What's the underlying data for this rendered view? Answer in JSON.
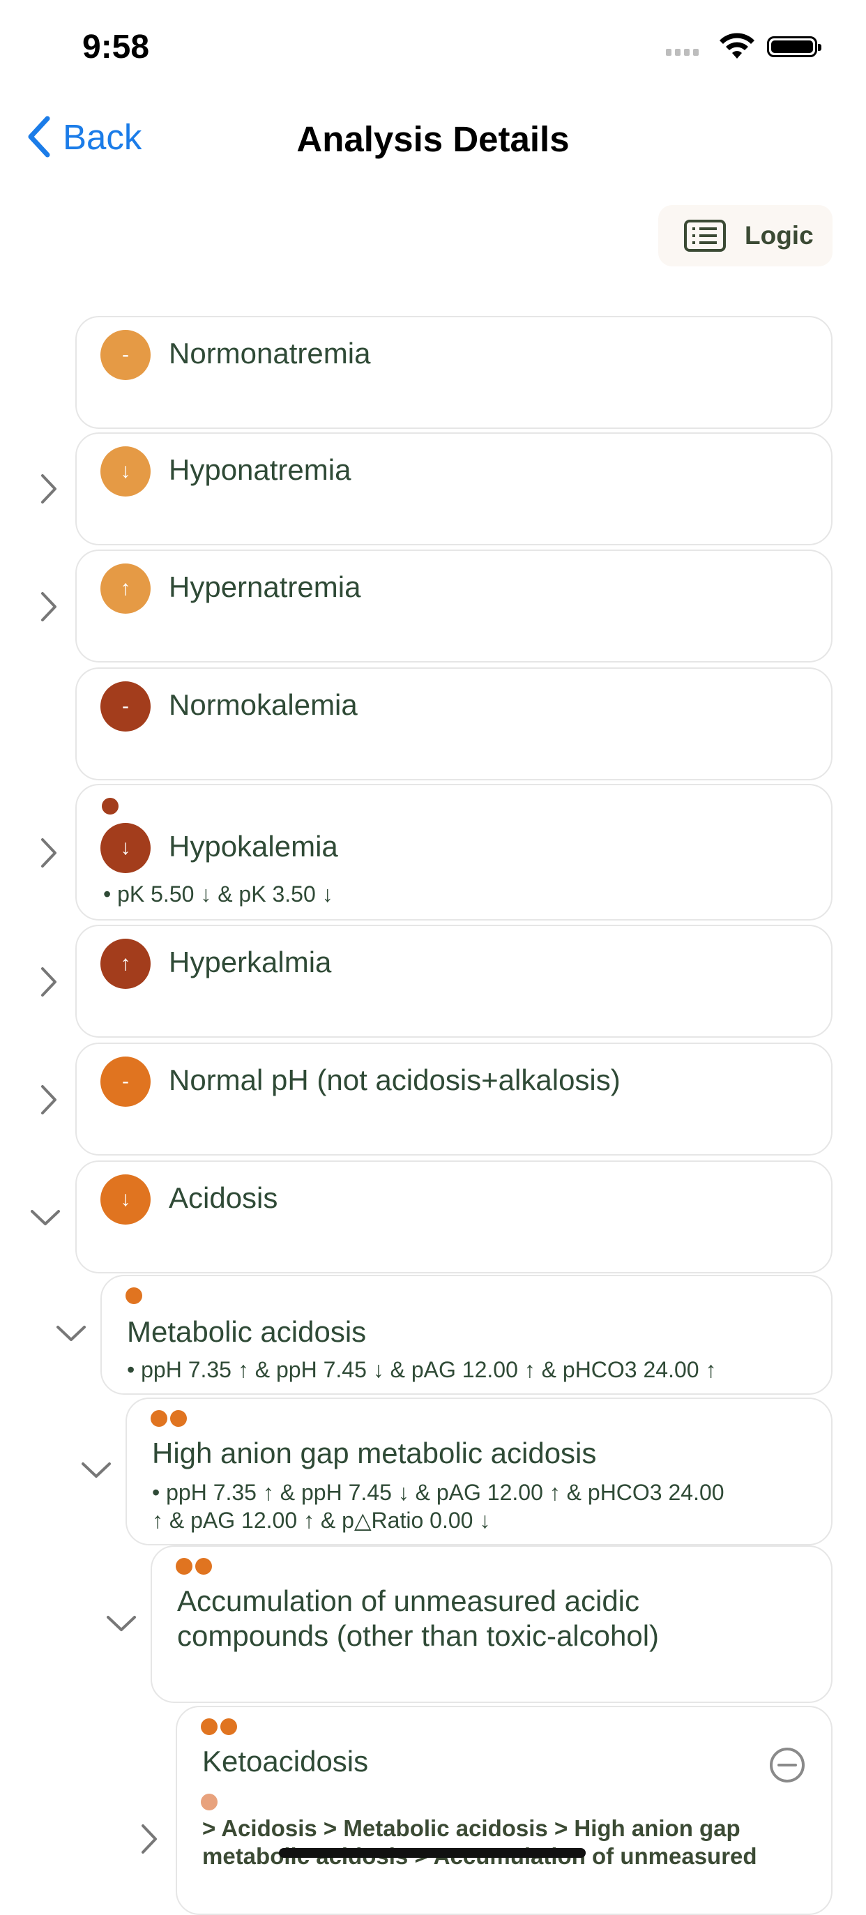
{
  "status": {
    "time": "9:58"
  },
  "nav": {
    "back_label": "Back",
    "title": "Analysis Details"
  },
  "toolbar": {
    "logic_label": "Logic"
  },
  "colors": {
    "sodium": "#e59a45",
    "potassium": "#a33d1c",
    "ph": "#e07420",
    "ph_dot": "#e07420",
    "light_dot": "#e8a27d"
  },
  "items": [
    {
      "title": "Normonatremia",
      "symbol": "-",
      "chevron": "none"
    },
    {
      "title": "Hyponatremia",
      "symbol": "↓",
      "chevron": "right"
    },
    {
      "title": "Hypernatremia",
      "symbol": "↑",
      "chevron": "right"
    },
    {
      "title": "Normokalemia",
      "symbol": "-",
      "chevron": "none"
    },
    {
      "title": "Hypokalemia",
      "symbol": "↓",
      "chevron": "right",
      "rule": "• pK 5.50 ↓ & pK 3.50 ↓"
    },
    {
      "title": "Hyperkalmia",
      "symbol": "↑",
      "chevron": "right"
    },
    {
      "title": "Normal pH (not acidosis+alkalosis)",
      "symbol": "-",
      "chevron": "right"
    },
    {
      "title": "Acidosis",
      "symbol": "↓",
      "chevron": "down"
    },
    {
      "title": "Metabolic acidosis",
      "chevron": "down",
      "rule": "• ppH 7.35 ↑ & ppH 7.45 ↓ & pAG 12.00 ↑ & pHCO3 24.00 ↑"
    },
    {
      "title": "High anion gap metabolic acidosis",
      "chevron": "down",
      "rule_line1": "• ppH 7.35 ↑ & ppH 7.45 ↓ & pAG 12.00 ↑ & pHCO3 24.00",
      "rule_line2": "↑ & pAG 12.00 ↑ & p△Ratio 0.00 ↓"
    },
    {
      "title_line1": "Accumulation of unmeasured acidic",
      "title_line2": "compounds (other than toxic-alcohol)",
      "chevron": "down"
    },
    {
      "title": "Ketoacidosis",
      "chevron": "right",
      "path_line1": " > Acidosis > Metabolic acidosis > High anion gap",
      "path_line2": "metabolic acidosis > Accumulation of unmeasured"
    }
  ]
}
